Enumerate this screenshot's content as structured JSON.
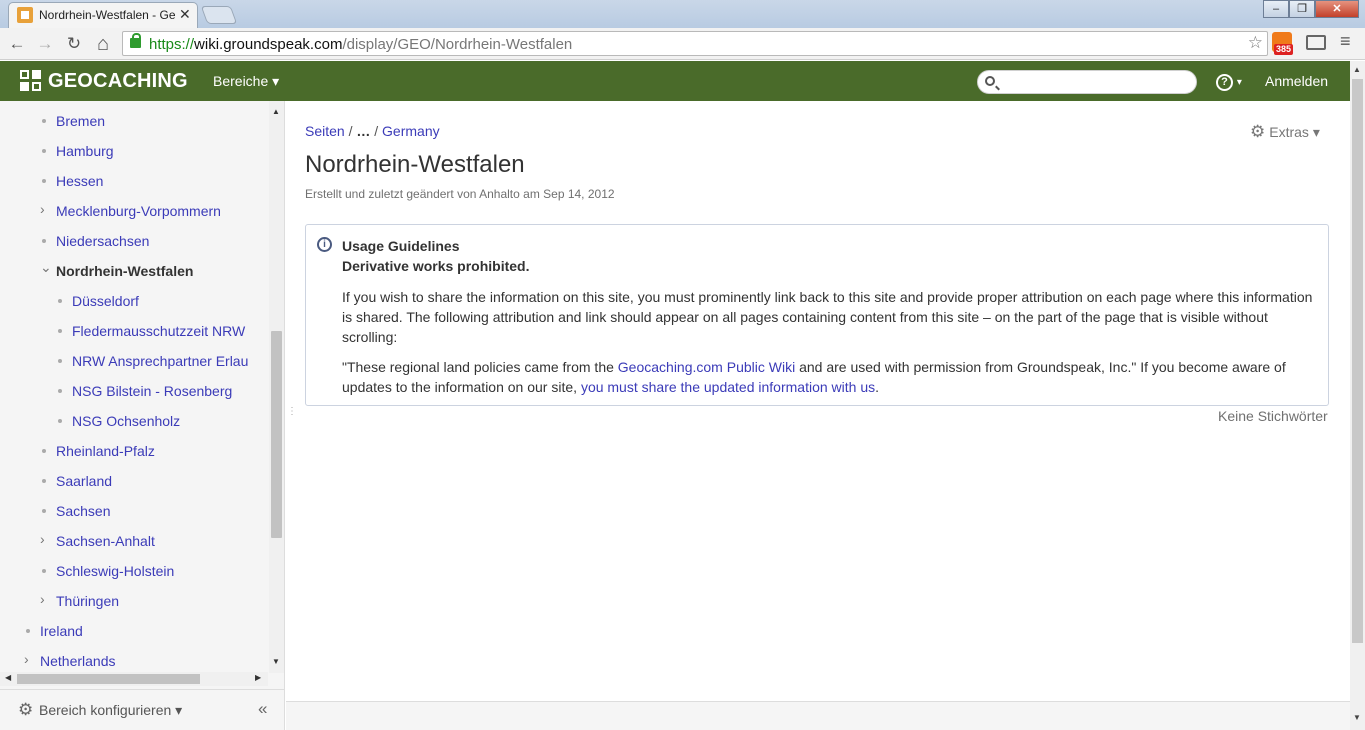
{
  "browser": {
    "tab_title": "Nordrhein-Westfalen - Ge",
    "tab_close": "✕",
    "url_scheme": "https://",
    "url_host": "wiki.groundspeak.com",
    "url_path": "/display/GEO/Nordrhein-Westfalen",
    "rss_badge": "385",
    "win_min": "‒",
    "win_max": "❐",
    "win_close": "✕",
    "back": "←",
    "forward": "→",
    "reload": "↻",
    "home": "⌂",
    "star": "☆",
    "menu": "≡"
  },
  "header": {
    "logo_text": "GEOCACHING",
    "bereiche": "Bereiche ▾",
    "help": "?",
    "help_caret": "▾",
    "login": "Anmelden",
    "brand_color": "#4a6b2a"
  },
  "sidebar": {
    "items": [
      {
        "label": "Bremen",
        "marker": "bullet",
        "level": 2
      },
      {
        "label": "Hamburg",
        "marker": "bullet",
        "level": 2
      },
      {
        "label": "Hessen",
        "marker": "bullet",
        "level": 2
      },
      {
        "label": "Mecklenburg-Vorpommern",
        "marker": "chevron-right",
        "level": 2
      },
      {
        "label": "Niedersachsen",
        "marker": "bullet",
        "level": 2
      },
      {
        "label": "Nordrhein-Westfalen",
        "marker": "chevron-down",
        "level": 2,
        "current": true
      },
      {
        "label": "Düsseldorf",
        "marker": "bullet",
        "level": 3
      },
      {
        "label": "Fledermausschutzzeit NRW",
        "marker": "bullet",
        "level": 3
      },
      {
        "label": "NRW Ansprechpartner Erlau",
        "marker": "bullet",
        "level": 3
      },
      {
        "label": "NSG Bilstein - Rosenberg",
        "marker": "bullet",
        "level": 3
      },
      {
        "label": "NSG Ochsenholz",
        "marker": "bullet",
        "level": 3
      },
      {
        "label": "Rheinland-Pfalz",
        "marker": "bullet",
        "level": 2
      },
      {
        "label": "Saarland",
        "marker": "bullet",
        "level": 2
      },
      {
        "label": "Sachsen",
        "marker": "bullet",
        "level": 2
      },
      {
        "label": "Sachsen-Anhalt",
        "marker": "chevron-right",
        "level": 2
      },
      {
        "label": "Schleswig-Holstein",
        "marker": "bullet",
        "level": 2
      },
      {
        "label": "Thüringen",
        "marker": "chevron-right",
        "level": 2
      },
      {
        "label": "Ireland",
        "marker": "bullet",
        "level": 1
      },
      {
        "label": "Netherlands",
        "marker": "chevron-right",
        "level": 1
      }
    ],
    "configure": "Bereich konfigurieren ▾",
    "collapse": "«"
  },
  "main": {
    "breadcrumb_root": "Seiten",
    "breadcrumb_sep1": " / ",
    "breadcrumb_ellipsis": "…",
    "breadcrumb_sep2": " / ",
    "breadcrumb_parent": "Germany",
    "extras": "Extras ▾",
    "title": "Nordrhein-Westfalen",
    "meta": "Erstellt und zuletzt geändert von Anhalto am Sep 14, 2012",
    "panel": {
      "heading": "Usage Guidelines",
      "subheading": "Derivative works prohibited.",
      "p1": "If you wish to share the information on this site, you must prominently link back to this site and provide proper attribution on each page where this information is shared. The following attribution and link should appear on all pages containing content from this site – on the part of the page that is visible without scrolling:",
      "p2_a": "\"These regional land policies came from the ",
      "p2_link1": "Geocaching.com Public Wiki",
      "p2_b": " and are used with permission from Groundspeak, Inc.\" If you become aware of updates to the information on our site, ",
      "p2_link2": "you must share the updated information with us",
      "p2_c": "."
    },
    "labels": "Keine Stichwörter"
  }
}
